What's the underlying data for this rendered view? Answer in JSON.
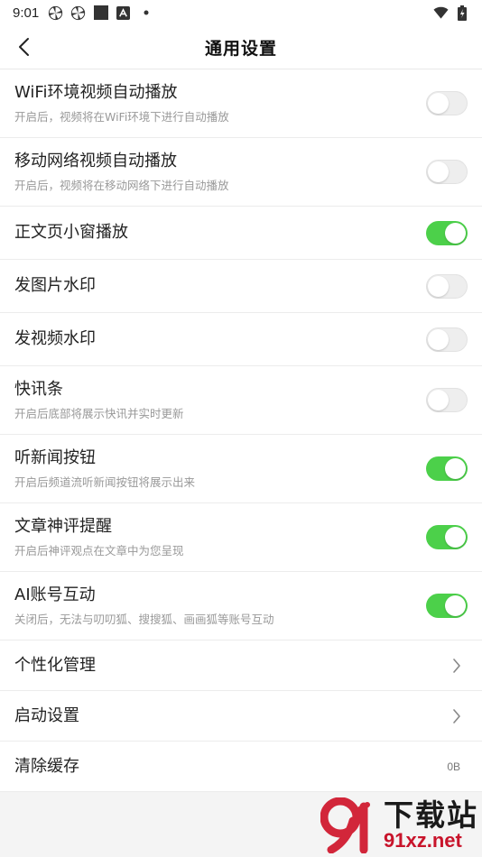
{
  "status_bar": {
    "time": "9:01",
    "icons": [
      "pinwheel-icon",
      "pinwheel-icon",
      "square-icon",
      "app-icon",
      "dot-icon"
    ],
    "right_icons": [
      "wifi-icon",
      "battery-icon"
    ]
  },
  "header": {
    "title": "通用设置",
    "back_icon": "chevron-left-icon"
  },
  "settings": [
    {
      "label": "WiFi环境视频自动播放",
      "sub": "开启后，视频将在WiFi环境下进行自动播放",
      "toggle": false
    },
    {
      "label": "移动网络视频自动播放",
      "sub": "开启后，视频将在移动网络下进行自动播放",
      "toggle": false
    },
    {
      "label": "正文页小窗播放",
      "toggle": true
    },
    {
      "label": "发图片水印",
      "toggle": false
    },
    {
      "label": "发视频水印",
      "toggle": false
    },
    {
      "label": "快讯条",
      "sub": "开启后底部将展示快讯并实时更新",
      "toggle": false
    },
    {
      "label": "听新闻按钮",
      "sub": "开启后频道流听新闻按钮将展示出来",
      "toggle": true
    },
    {
      "label": "文章神评提醒",
      "sub": "开启后神评观点在文章中为您呈现",
      "toggle": true
    },
    {
      "label": "AI账号互动",
      "sub": "关闭后，无法与叨叨狐、搜搜狐、画画狐等账号互动",
      "toggle": true
    }
  ],
  "nav_items": [
    {
      "label": "个性化管理",
      "icon": "chevron-right-icon"
    },
    {
      "label": "启动设置",
      "icon": "chevron-right-icon"
    },
    {
      "label": "清除缓存",
      "value": "0B"
    }
  ],
  "watermark": {
    "text": "下载站",
    "url": "91xz.net"
  },
  "colors": {
    "toggle_on": "#4cd04a",
    "toggle_off": "#eeeeee",
    "background": "#f4f4f4",
    "watermark_red": "#c8142b"
  }
}
